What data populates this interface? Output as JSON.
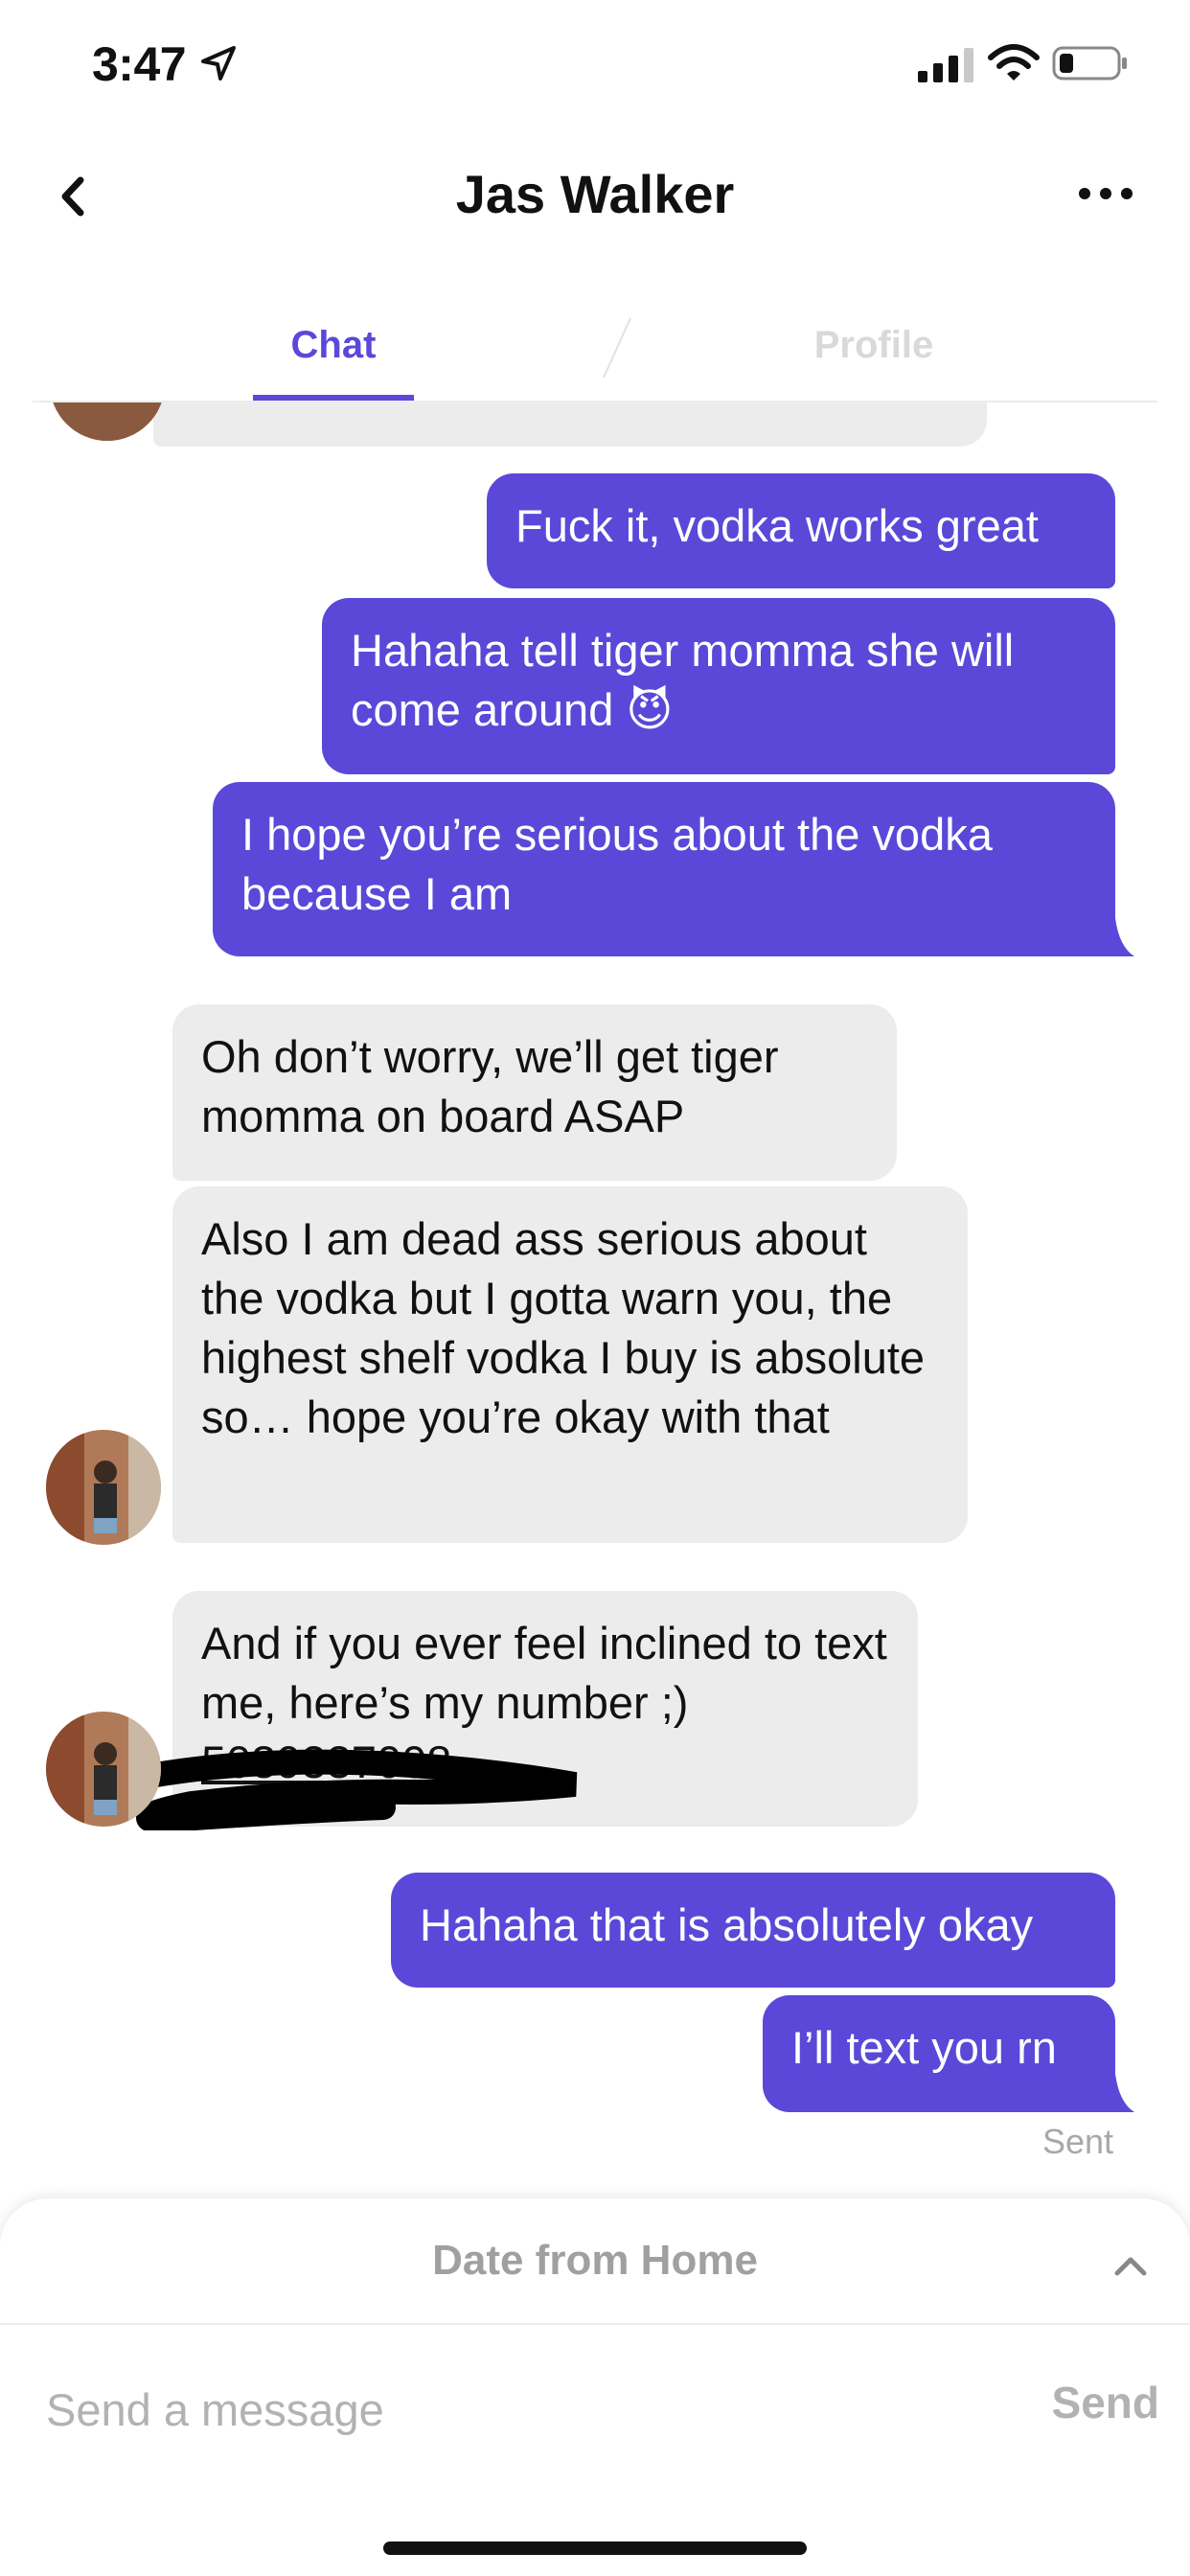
{
  "status_bar": {
    "time": "3:47",
    "icons": [
      "location-arrow-icon",
      "cellular-signal-icon",
      "wifi-icon",
      "battery-icon"
    ]
  },
  "header": {
    "title": "Jas Walker",
    "back_icon": "chevron-left-icon",
    "more_icon": "more-dots-icon"
  },
  "tabs": [
    {
      "label": "Chat",
      "active": true
    },
    {
      "label": "Profile",
      "active": false
    }
  ],
  "messages": [
    {
      "from": "me",
      "text": "Fuck it, vodka works great"
    },
    {
      "from": "me",
      "text": "Hahaha tell tiger momma she will come around 😈"
    },
    {
      "from": "me",
      "text": "I hope you’re serious about the vodka because I am"
    },
    {
      "from": "them",
      "text": "Oh don’t worry, we’ll get tiger momma on board ASAP"
    },
    {
      "from": "them",
      "text": "Also I am dead ass serious about the vodka but I gotta warn you, the highest shelf vodka I buy is absolute so… hope you’re okay with that"
    },
    {
      "from": "them",
      "text": "And if you ever feel inclined to text me, here’s my number ;)",
      "link": "5039337008"
    },
    {
      "from": "me",
      "text": "Hahaha that is absolutely okay"
    },
    {
      "from": "me",
      "text": "I’ll text you rn"
    }
  ],
  "sent_status": "Sent",
  "bottom_panel": {
    "title": "Date from Home",
    "input_placeholder": "Send a message",
    "send_label": "Send"
  },
  "colors": {
    "accent": "#5b48d9",
    "received_bubble": "#ececec",
    "muted_text": "#b2b2b2"
  }
}
